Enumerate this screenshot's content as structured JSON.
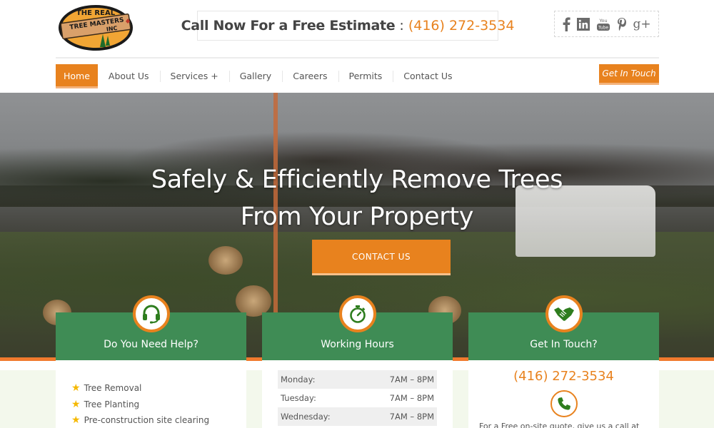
{
  "brand": {
    "logo_line1": "THE REAL",
    "logo_line2": "TREE MASTERS",
    "logo_line3": "INC",
    "colors": {
      "accent": "#e8821e",
      "green": "#3f8c55",
      "dark_green": "#2e7d1e",
      "star": "#f5b800"
    }
  },
  "header": {
    "call_label": "Call Now For a Free Estimate",
    "call_separator": ":",
    "phone": "(416) 272-3534",
    "social": [
      {
        "name": "facebook",
        "glyph": "f"
      },
      {
        "name": "linkedin",
        "glyph": "in"
      },
      {
        "name": "youtube",
        "glyph": "You Tube"
      },
      {
        "name": "pinterest",
        "glyph": "P"
      },
      {
        "name": "google-plus",
        "glyph": "g+"
      }
    ]
  },
  "nav": {
    "items": [
      {
        "label": "Home",
        "active": true
      },
      {
        "label": "About Us"
      },
      {
        "label": "Services +"
      },
      {
        "label": "Gallery"
      },
      {
        "label": "Careers"
      },
      {
        "label": "Permits"
      },
      {
        "label": "Contact Us"
      }
    ],
    "cta_label": "Get In Touch"
  },
  "hero": {
    "headline_line1": "Safely & Efficiently Remove Trees",
    "headline_line2": "From Your Property",
    "cta_label": "CONTACT US"
  },
  "cards": [
    {
      "title": "Do You Need Help?",
      "icon": "headset-icon",
      "services": [
        "Tree Removal",
        "Tree Planting",
        "Pre-construction site clearing"
      ]
    },
    {
      "title": "Working Hours",
      "icon": "stopwatch-icon",
      "hours": [
        {
          "day": "Monday:",
          "time": "7AM – 8PM"
        },
        {
          "day": "Tuesday:",
          "time": "7AM – 8PM"
        },
        {
          "day": "Wednesday:",
          "time": "7AM – 8PM"
        }
      ]
    },
    {
      "title": "Get In Touch?",
      "icon": "handshake-icon",
      "phone": "(416) 272-3534",
      "note": "For a Free on-site quote, give us a call at"
    }
  ]
}
